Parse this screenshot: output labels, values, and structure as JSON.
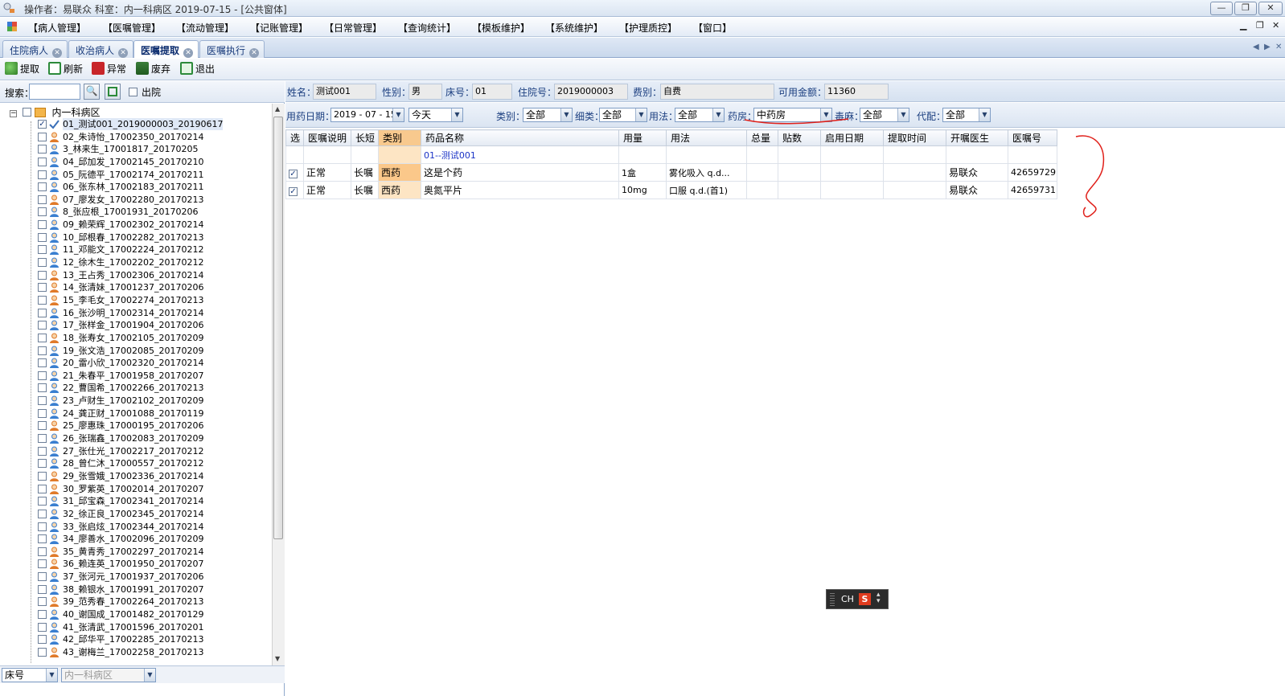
{
  "window": {
    "title": "操作者：易联众  科室：内一科病区  2019-07-15 - [公共窗体]",
    "minimize_symbol": "—",
    "restore_symbol": "❐",
    "close_symbol": "✕"
  },
  "menu": [
    "【病人管理】",
    "【医嘱管理】",
    "【流动管理】",
    "【记账管理】",
    "【日常管理】",
    "【查询统计】",
    "【模板维护】",
    "【系统维护】",
    "【护理质控】",
    "【窗口】"
  ],
  "tabs": [
    {
      "label": "住院病人",
      "active": false
    },
    {
      "label": "收治病人",
      "active": false
    },
    {
      "label": "医嘱提取",
      "active": true
    },
    {
      "label": "医嘱执行",
      "active": false
    }
  ],
  "toolbar": {
    "extract": "提取",
    "refresh": "刷新",
    "abnormal": "异常",
    "discard": "废弃",
    "exit": "退出"
  },
  "left": {
    "search_label": "搜索：",
    "search_value": "",
    "discharged_label": "出院",
    "root_label": "内一科病区",
    "patients": [
      {
        "label": "01_测试001_2019000003_20190617",
        "checked": true,
        "gender": "m",
        "selected": true
      },
      {
        "label": "02_朱诗怡_17002350_20170214",
        "checked": false,
        "gender": "f"
      },
      {
        "label": "3_林来生_17001817_20170205",
        "checked": false,
        "gender": "m"
      },
      {
        "label": "04_邱加发_17002145_20170210",
        "checked": false,
        "gender": "m"
      },
      {
        "label": "05_阮德平_17002174_20170211",
        "checked": false,
        "gender": "m"
      },
      {
        "label": "06_张东林_17002183_20170211",
        "checked": false,
        "gender": "m"
      },
      {
        "label": "07_廖发女_17002280_20170213",
        "checked": false,
        "gender": "f"
      },
      {
        "label": "8_张应根_17001931_20170206",
        "checked": false,
        "gender": "m"
      },
      {
        "label": "09_赖荣辉_17002302_20170214",
        "checked": false,
        "gender": "m"
      },
      {
        "label": "10_邱根春_17002282_20170213",
        "checked": false,
        "gender": "m"
      },
      {
        "label": "11_邓能文_17002224_20170212",
        "checked": false,
        "gender": "m"
      },
      {
        "label": "12_徐木生_17002202_20170212",
        "checked": false,
        "gender": "m"
      },
      {
        "label": "13_王占秀_17002306_20170214",
        "checked": false,
        "gender": "f"
      },
      {
        "label": "14_张清妹_17001237_20170206",
        "checked": false,
        "gender": "f"
      },
      {
        "label": "15_李毛女_17002274_20170213",
        "checked": false,
        "gender": "f"
      },
      {
        "label": "16_张沙明_17002314_20170214",
        "checked": false,
        "gender": "m"
      },
      {
        "label": "17_张样金_17001904_20170206",
        "checked": false,
        "gender": "m"
      },
      {
        "label": "18_张寿女_17002105_20170209",
        "checked": false,
        "gender": "f"
      },
      {
        "label": "19_张文浩_17002085_20170209",
        "checked": false,
        "gender": "m"
      },
      {
        "label": "20_雷小欣_17002320_20170214",
        "checked": false,
        "gender": "m"
      },
      {
        "label": "21_朱春平_17001958_20170207",
        "checked": false,
        "gender": "m"
      },
      {
        "label": "22_曹国希_17002266_20170213",
        "checked": false,
        "gender": "m"
      },
      {
        "label": "23_卢财生_17002102_20170209",
        "checked": false,
        "gender": "m"
      },
      {
        "label": "24_龚正财_17001088_20170119",
        "checked": false,
        "gender": "m"
      },
      {
        "label": "25_廖惠珠_17000195_20170206",
        "checked": false,
        "gender": "f"
      },
      {
        "label": "26_张瑞鑫_17002083_20170209",
        "checked": false,
        "gender": "m"
      },
      {
        "label": "27_张仕光_17002217_20170212",
        "checked": false,
        "gender": "m"
      },
      {
        "label": "28_曾仁沐_17000557_20170212",
        "checked": false,
        "gender": "m"
      },
      {
        "label": "29_张雪娥_17002336_20170214",
        "checked": false,
        "gender": "f"
      },
      {
        "label": "30_罗紫英_17002014_20170207",
        "checked": false,
        "gender": "f"
      },
      {
        "label": "31_邱宝森_17002341_20170214",
        "checked": false,
        "gender": "m"
      },
      {
        "label": "32_徐正良_17002345_20170214",
        "checked": false,
        "gender": "m"
      },
      {
        "label": "33_张启炫_17002344_20170214",
        "checked": false,
        "gender": "m"
      },
      {
        "label": "34_廖善水_17002096_20170209",
        "checked": false,
        "gender": "m"
      },
      {
        "label": "35_黄青秀_17002297_20170214",
        "checked": false,
        "gender": "f"
      },
      {
        "label": "36_赖连英_17001950_20170207",
        "checked": false,
        "gender": "f"
      },
      {
        "label": "37_张河元_17001937_20170206",
        "checked": false,
        "gender": "m"
      },
      {
        "label": "38_赖银水_17001991_20170207",
        "checked": false,
        "gender": "m"
      },
      {
        "label": "39_范秀春_17002264_20170213",
        "checked": false,
        "gender": "f"
      },
      {
        "label": "40_谢国成_17001482_20170129",
        "checked": false,
        "gender": "m"
      },
      {
        "label": "41_张清武_17001596_20170201",
        "checked": false,
        "gender": "m"
      },
      {
        "label": "42_邱华平_17002285_20170213",
        "checked": false,
        "gender": "m"
      },
      {
        "label": "43_谢梅兰_17002258_20170213",
        "checked": false,
        "gender": "f"
      }
    ],
    "bottom_combo1": "床号",
    "bottom_combo2": "内一科病区"
  },
  "info": {
    "name_label": "姓名：",
    "name": "测试001",
    "gender_label": "性别：",
    "gender": "男",
    "bed_label": "床号：",
    "bed": "01",
    "admission_label": "住院号：",
    "admission": "2019000003",
    "fee_label": "费别：",
    "fee": "自费",
    "balance_label": "可用金额：",
    "balance": "11360"
  },
  "filters": {
    "date_label": "用药日期：",
    "date": "2019 - 07 - 15",
    "day": "今天",
    "type_label": "类别：",
    "type": "全部",
    "subtype_label": "细类：",
    "subtype": "全部",
    "usage_label": "用法：",
    "usage": "全部",
    "pharmacy_label": "药房：",
    "pharmacy": "中药房",
    "poison_label": "毒麻：",
    "poison": "全部",
    "proxy_label": "代配：",
    "proxy": "全部"
  },
  "grid": {
    "headers": [
      "选",
      "医嘱说明",
      "长短",
      "类别",
      "药品名称",
      "用量",
      "用法",
      "总量",
      "贴数",
      "启用日期",
      "提取时间",
      "开嘱医生",
      "医嘱号"
    ],
    "group_label": "01--测试001",
    "rows": [
      {
        "checked": true,
        "note": "正常",
        "term": "长嘱",
        "category": "西药",
        "drug": "这是个药",
        "dose": "1盒",
        "usage": "雾化吸入  q.d...",
        "total": "",
        "paste": "",
        "start": "",
        "extract_time": "",
        "doctor": "易联众",
        "order_no": "42659729"
      },
      {
        "checked": true,
        "note": "正常",
        "term": "长嘱",
        "category": "西药",
        "drug": "奥氮平片",
        "dose": "10mg",
        "usage": "口服  q.d.(首1)",
        "total": "",
        "paste": "",
        "start": "",
        "extract_time": "",
        "doctor": "易联众",
        "order_no": "42659731"
      }
    ]
  },
  "ime": {
    "mode": "CH",
    "logo": "S"
  },
  "colors": {
    "annotation_red": "#e0201a",
    "highlight_orange": "#fbc88a",
    "group_blue": "#1a33c6"
  }
}
